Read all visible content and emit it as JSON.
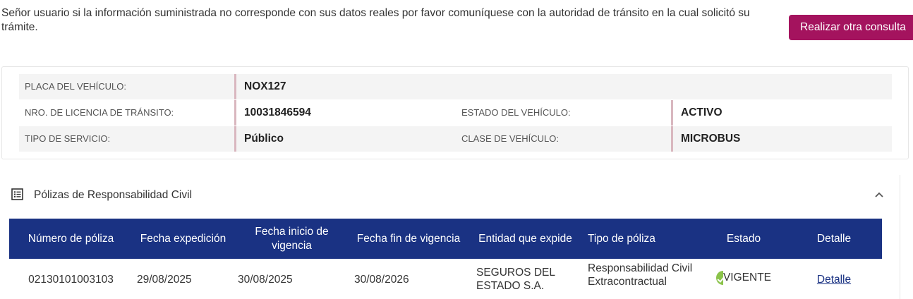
{
  "notice": "Señor usuario si la información suministrada no corresponde con sus datos reales por favor comuníquese con la autoridad de tránsito en la cual solicitó su trámite.",
  "button_consulta": "Realizar otra consulta",
  "vehicle": {
    "placa_label": "PLACA DEL VEHÍCULO:",
    "placa_value": "NOX127",
    "licencia_label": "NRO. DE LICENCIA DE TRÁNSITO:",
    "licencia_value": "10031846594",
    "estado_label": "ESTADO DEL VEHÍCULO:",
    "estado_value": "ACTIVO",
    "servicio_label": "TIPO DE SERVICIO:",
    "servicio_value": "Público",
    "clase_label": "CLASE DE VEHÍCULO:",
    "clase_value": "MICROBUS"
  },
  "polizas": {
    "title": "Pólizas de Responsabilidad Civil",
    "columns": [
      "Número de póliza",
      "Fecha expedición",
      "Fecha inicio de vigencia",
      "Fecha fin de vigencia",
      "Entidad que expide",
      "Tipo de póliza",
      "Estado",
      "Detalle"
    ],
    "rows": [
      {
        "numero": "02130101003103",
        "expedicion": "29/08/2025",
        "inicio": "30/08/2025",
        "fin": "30/08/2026",
        "entidad": "SEGUROS DEL ESTADO S.A.",
        "tipo": "Responsabilidad Civil Extracontractual",
        "estado": "VIGENTE",
        "detalle": "Detalle"
      }
    ]
  },
  "colors": {
    "accent": "#a4135e",
    "header": "#1a3283",
    "status_ok": "#8bc34a"
  },
  "icons": {
    "section": "list-icon",
    "collapse": "chevron-up-icon",
    "status": "check-circle-icon"
  }
}
